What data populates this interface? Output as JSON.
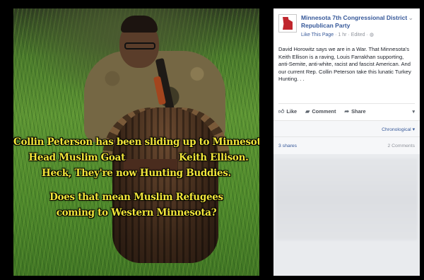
{
  "photo": {
    "caption_lines": [
      "Collin Peterson has been sliding up to Minnesota's",
      "Head Muslim Goat",
      "Keith Ellison.",
      "Heck, They're now Hunting Buddies.",
      "Does that mean Muslim Refugees",
      "coming to Western Minnesota?"
    ]
  },
  "post": {
    "page_name": "Minnesota 7th Congressional District Republican Party",
    "like_link": "Like This Page",
    "time": "1 hr",
    "edited": "Edited",
    "body": "David Horowitz says we are in a War. That Minnesota's Keith Ellison is a raving, Louis Farrakhan supporting, anti-Semite, anti-white, racist and fascist American. And our current Rep. Collin Peterson take this lunatic Turkey Hunting. . .",
    "actions": {
      "like": "Like",
      "comment": "Comment",
      "share": "Share"
    },
    "sort_label": "Chronological",
    "shares": "3 shares",
    "comments": "2 Comments"
  },
  "colors": {
    "link": "#365899",
    "caption": "#f2e63a",
    "logo": "#c0262d"
  },
  "icons": [
    "minnesota-logo-icon",
    "globe-icon",
    "chevron-down-icon",
    "thumbs-up-icon",
    "comment-icon",
    "share-arrow-icon"
  ]
}
